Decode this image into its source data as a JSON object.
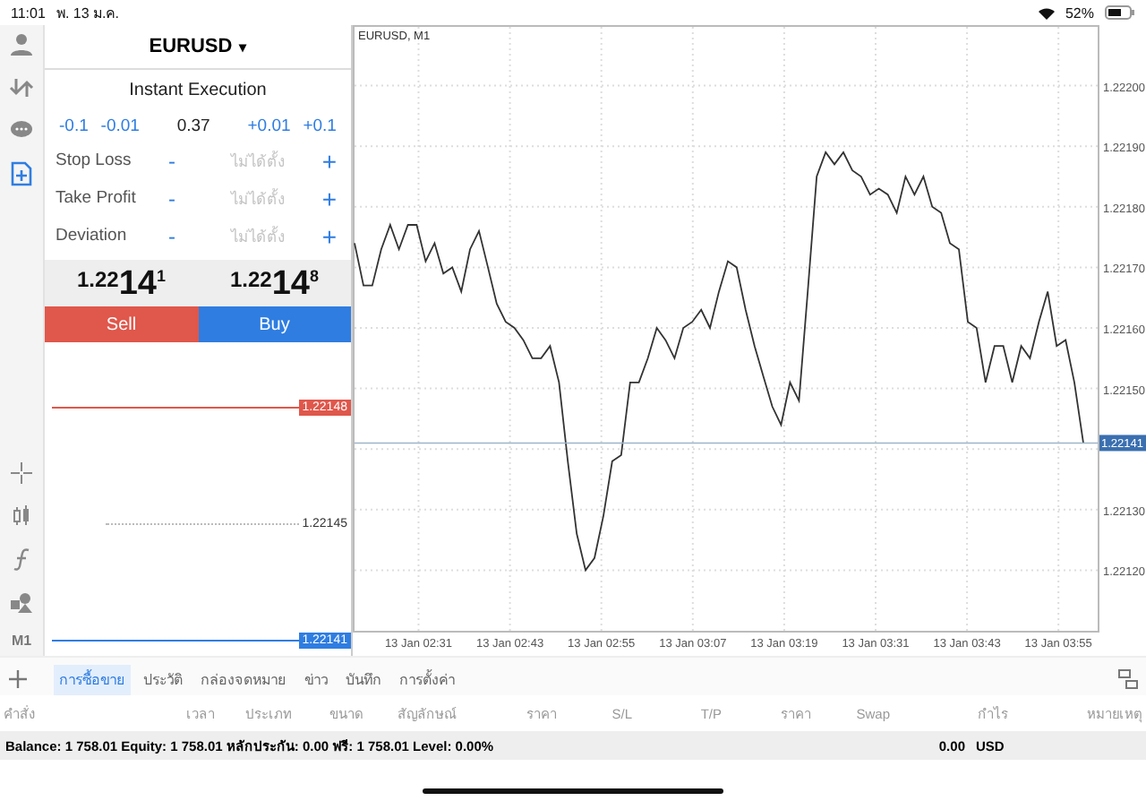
{
  "status_bar": {
    "time": "11:01",
    "date": "พ. 13 ม.ค.",
    "battery": "52%"
  },
  "order_panel": {
    "symbol": "EURUSD",
    "caret": "▾",
    "execution": "Instant Execution",
    "volume_steps": [
      {
        "label": "-0.1"
      },
      {
        "label": "-0.01"
      },
      {
        "label": "0.37",
        "kind": "value"
      },
      {
        "label": "+0.01"
      },
      {
        "label": "+0.1"
      }
    ],
    "fields": [
      {
        "label": "Stop Loss",
        "minus": "-",
        "placeholder": "ไม่ได้ตั้ง",
        "plus": "+"
      },
      {
        "label": "Take Profit",
        "minus": "-",
        "placeholder": "ไม่ได้ตั้ง",
        "plus": "+"
      },
      {
        "label": "Deviation",
        "minus": "-",
        "placeholder": "ไม่ได้ตั้ง",
        "plus": "+"
      }
    ],
    "bid": {
      "prefix": "1.22",
      "big": "14",
      "sup": "1"
    },
    "ask": {
      "prefix": "1.22",
      "big": "14",
      "sup": "8"
    },
    "sell": "Sell",
    "buy": "Buy",
    "depth": [
      {
        "kind": "ask",
        "price": "1.22148"
      },
      {
        "kind": "mid",
        "price": "1.22145"
      },
      {
        "kind": "bid",
        "price": "1.22141"
      }
    ]
  },
  "toolbar_bottom_label": "M1",
  "chart": {
    "title": "EURUSD, M1",
    "time_labels": [
      "13 Jan 02:31",
      "13 Jan 02:43",
      "13 Jan 02:55",
      "13 Jan 03:07",
      "13 Jan 03:19",
      "13 Jan 03:31",
      "13 Jan 03:43",
      "13 Jan 03:55"
    ],
    "chart_data": {
      "type": "line",
      "ylim": [
        1.2211,
        1.2221
      ],
      "grid": true,
      "yticks": [
        {
          "value": 1.2212,
          "label": "1.22120"
        },
        {
          "value": 1.2213,
          "label": "1.22130"
        },
        {
          "value": 1.2215,
          "label": "1.22150"
        },
        {
          "value": 1.2216,
          "label": "1.22160"
        },
        {
          "value": 1.2217,
          "label": "1.22170"
        },
        {
          "value": 1.2218,
          "label": "1.22180"
        },
        {
          "value": 1.2219,
          "label": "1.22190"
        },
        {
          "value": 1.222,
          "label": "1.22200"
        }
      ],
      "ref_lines": [
        {
          "value": 1.22141,
          "label": "1.22141",
          "color": "#9fb4c8",
          "axis": "y"
        }
      ],
      "series": [
        {
          "color": "#333333",
          "values": [
            1.22174,
            1.22167,
            1.22167,
            1.22173,
            1.22177,
            1.22173,
            1.22177,
            1.22177,
            1.22171,
            1.22174,
            1.22169,
            1.2217,
            1.22166,
            1.22173,
            1.22176,
            1.2217,
            1.22164,
            1.22161,
            1.2216,
            1.22158,
            1.22155,
            1.22155,
            1.22157,
            1.22151,
            1.22138,
            1.22126,
            1.2212,
            1.22122,
            1.22129,
            1.22138,
            1.22139,
            1.22151,
            1.22151,
            1.22155,
            1.2216,
            1.22158,
            1.22155,
            1.2216,
            1.22161,
            1.22163,
            1.2216,
            1.22166,
            1.22171,
            1.2217,
            1.22163,
            1.22157,
            1.22152,
            1.22147,
            1.22144,
            1.22151,
            1.22148,
            1.22166,
            1.22185,
            1.22189,
            1.22187,
            1.22189,
            1.22186,
            1.22185,
            1.22182,
            1.22183,
            1.22182,
            1.22179,
            1.22185,
            1.22182,
            1.22185,
            1.2218,
            1.22179,
            1.22174,
            1.22173,
            1.22161,
            1.2216,
            1.22151,
            1.22157,
            1.22157,
            1.22151,
            1.22157,
            1.22155,
            1.22161,
            1.22166,
            1.22157,
            1.22158,
            1.22151,
            1.22141
          ]
        }
      ]
    }
  },
  "tabs": [
    {
      "label": "การซื้อขาย",
      "selected": true
    },
    {
      "label": "ประวัติ",
      "selected": false
    },
    {
      "label": "กล่องจดหมาย",
      "selected": false
    },
    {
      "label": "ข่าว",
      "selected": false
    },
    {
      "label": "บันทึก",
      "selected": false
    },
    {
      "label": "การตั้งค่า",
      "selected": false
    }
  ],
  "columns": [
    "คำสั่ง",
    "เวลา",
    "ประเภท",
    "ขนาด",
    "สัญลักษณ์",
    "ราคา",
    "S/L",
    "T/P",
    "ราคา",
    "Swap",
    "กำไร",
    "หมายเหตุ"
  ],
  "summary": {
    "text": "Balance: 1 758.01 Equity: 1 758.01 หลักประกัน: 0.00 ฟรี: 1 758.01 Level: 0.00%",
    "profit": "0.00",
    "currency": "USD"
  }
}
